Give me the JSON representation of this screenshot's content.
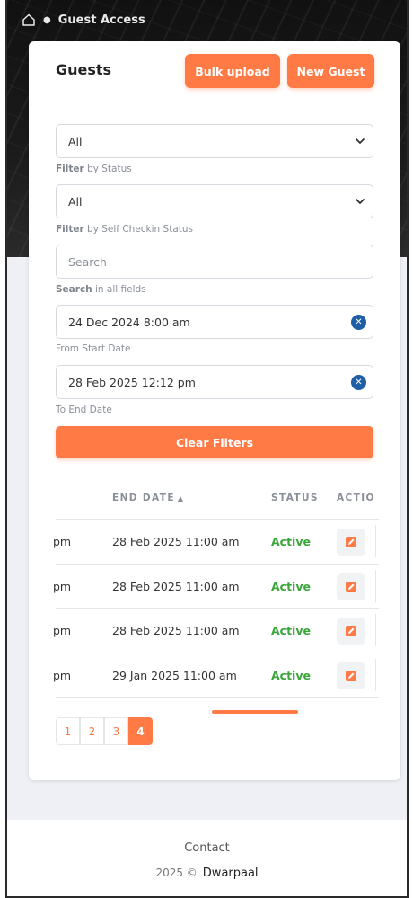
{
  "breadcrumb": {
    "current": "Guest Access"
  },
  "page": {
    "title": "Guests",
    "bulk_upload_label": "Bulk upload",
    "new_guest_label": "New Guest"
  },
  "filters": {
    "status": {
      "value": "All",
      "hint_bold": "Filter",
      "hint_rest": " by Status"
    },
    "self_checkin": {
      "value": "All",
      "hint_bold": "Filter",
      "hint_rest": " by Self Checkin Status"
    },
    "search": {
      "placeholder": "Search",
      "hint_bold": "Search",
      "hint_rest": " in all fields"
    },
    "start_date": {
      "value": "24 Dec 2024 8:00 am",
      "hint": "From Start Date"
    },
    "end_date": {
      "value": "28 Feb 2025 12:12 pm",
      "hint": "To End Date"
    },
    "clear_label": "Clear Filters"
  },
  "table": {
    "headers": {
      "end_date": "END DATE",
      "status": "STATUS",
      "action": "ACTIO"
    },
    "rows": [
      {
        "start": "pm",
        "end": "28 Feb 2025 11:00 am",
        "status": "Active"
      },
      {
        "start": "pm",
        "end": "28 Feb 2025 11:00 am",
        "status": "Active"
      },
      {
        "start": "pm",
        "end": "28 Feb 2025 11:00 am",
        "status": "Active"
      },
      {
        "start": "pm",
        "end": "29 Jan 2025 11:00 am",
        "status": "Active"
      }
    ]
  },
  "pagination": {
    "pages": [
      "1",
      "2",
      "3",
      "4"
    ],
    "active": "4"
  },
  "footer": {
    "contact": "Contact",
    "copyright": "2025 ©",
    "brand": "Dwarpaal"
  },
  "colors": {
    "accent": "#ff7a45",
    "status_active": "#3aa53a",
    "clear_icon": "#1f5fa8"
  }
}
